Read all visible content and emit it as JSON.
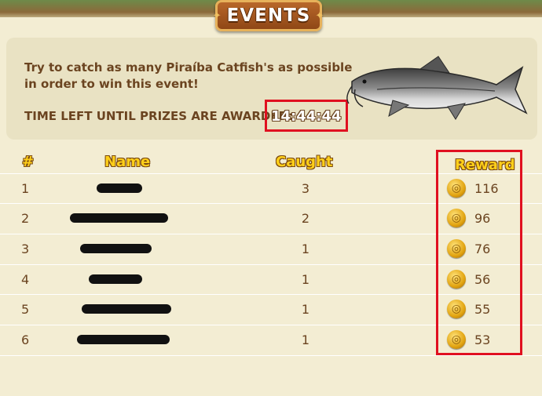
{
  "window": {
    "tab_title": "EVENTS"
  },
  "event": {
    "description": "Try to catch as many Piraíba Catfish's as possible in order to win this event!",
    "time_label": "TIME LEFT UNTIL PRIZES ARE AWARDED:",
    "time_value": "14:44:44",
    "fish_icon": "catfish-image"
  },
  "table": {
    "headers": {
      "rank": "#",
      "name": "Name",
      "caught": "Caught",
      "reward": "Reward"
    },
    "rows": [
      {
        "rank": "1",
        "caught": "3",
        "reward": "116"
      },
      {
        "rank": "2",
        "caught": "2",
        "reward": "96"
      },
      {
        "rank": "3",
        "caught": "1",
        "reward": "76"
      },
      {
        "rank": "4",
        "caught": "1",
        "reward": "56"
      },
      {
        "rank": "5",
        "caught": "1",
        "reward": "55"
      },
      {
        "rank": "6",
        "caught": "1",
        "reward": "53"
      }
    ]
  },
  "colors": {
    "highlight": "#e01020",
    "header_gold": "#ffcf1a",
    "text_brown": "#6b4420"
  }
}
